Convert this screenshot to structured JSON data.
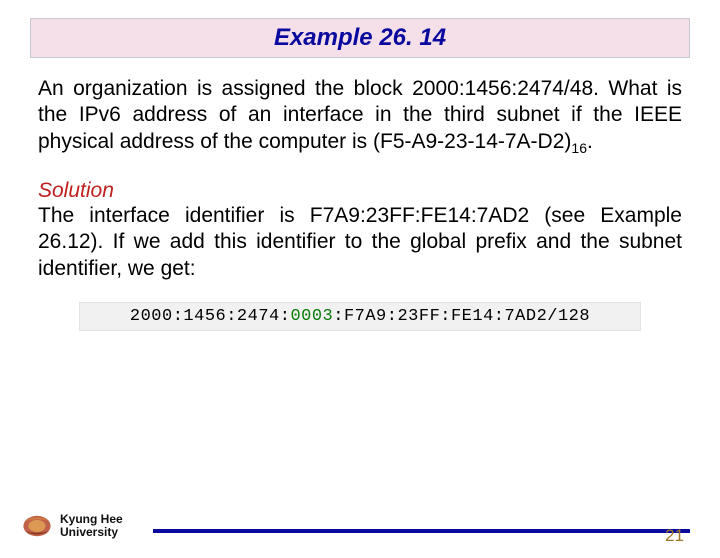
{
  "header": {
    "title": "Example 26. 14"
  },
  "problem": {
    "p1a": "An organization is assigned the block ",
    "addr": "2000:1456:2474/48",
    "p1b": ". What is the IPv6 address of an interface in the third subnet if the IEEE physical address of the computer is ",
    "mac": "(F5-A9-23-14-7A-D2)",
    "sub": "16",
    "p1c": "."
  },
  "solution": {
    "title": "Solution",
    "body": "The interface identifier is F7A9:23FF:FE14:7AD2 (see Example 26.12). If we add this identifier to the global prefix and the subnet identifier, we get:"
  },
  "ipv6": {
    "part1": "2000:1456:2474:",
    "part2": "0003",
    "part3": ":F7A9:23FF:FE14:7AD2/128"
  },
  "footer": {
    "uni_line1": "Kyung Hee",
    "uni_line2": "University",
    "page": "21"
  }
}
